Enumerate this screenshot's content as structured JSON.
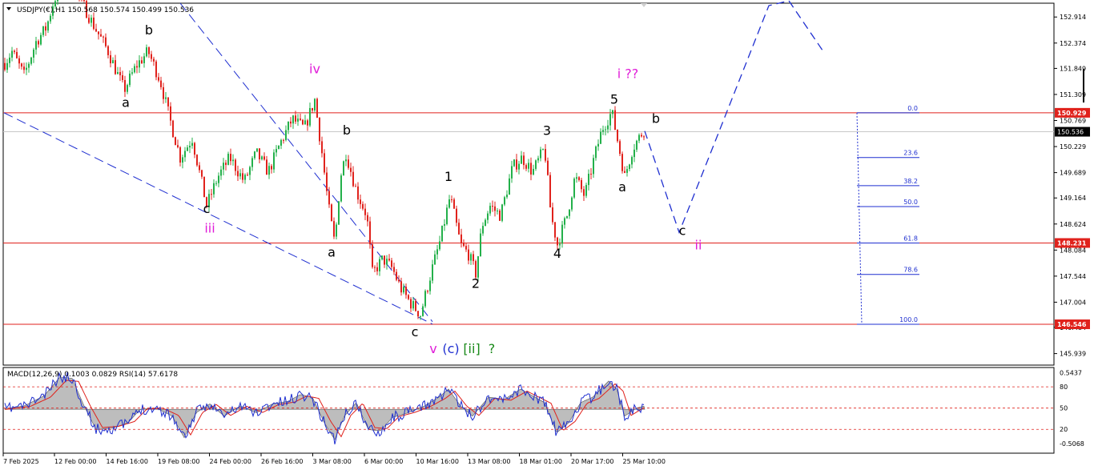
{
  "header": {
    "symbol_line": "USDJPY(€),H1  150.568 150.574 150.499 150.536",
    "indicator_line": "MACD(12,26,9) 0.1003 0.0829  RSI(14) 57.6178"
  },
  "colors": {
    "bull": "#23b04a",
    "bear": "#e0221c",
    "level": "#e0221c",
    "channel": "#1f2fd0",
    "projection": "#1f2fd0",
    "fib": "#1f2fd0",
    "magenta": "#e01cd8",
    "black": "#000000",
    "macd_hist": "#bdbdbd",
    "rsi": "#1f2fd0",
    "signal": "#e0221c",
    "green_label": "#1a8a1a"
  },
  "chart_data": [
    {
      "type": "line",
      "name": "price",
      "instrument": "USDJPY(€)",
      "timeframe": "H1",
      "ohlc": {
        "open": 150.568,
        "high": 150.574,
        "low": 150.499,
        "close": 150.536
      },
      "ylim": [
        145.7,
        153.2
      ],
      "y_ticks": [
        "152.914",
        "152.374",
        "151.849",
        "151.309",
        "150.769",
        "150.229",
        "149.689",
        "149.164",
        "148.624",
        "148.084",
        "147.544",
        "147.004",
        "146.484",
        "145.939"
      ],
      "x_ticks": [
        "7 Feb 2025",
        "12 Feb 00:00",
        "14 Feb 16:00",
        "19 Feb 08:00",
        "24 Feb 00:00",
        "26 Feb 16:00",
        "3 Mar 08:00",
        "6 Mar 00:00",
        "10 Mar 16:00",
        "13 Mar 08:00",
        "18 Mar 01:00",
        "20 Mar 17:00",
        "25 Mar 10:00"
      ],
      "swing_path": [
        [
          0,
          151.8
        ],
        [
          15,
          152.2
        ],
        [
          30,
          151.7
        ],
        [
          45,
          152.4
        ],
        [
          58,
          152.7
        ],
        [
          68,
          153.3
        ],
        [
          85,
          153.6
        ],
        [
          100,
          153.3
        ],
        [
          115,
          152.8
        ],
        [
          135,
          152.2
        ],
        [
          155,
          151.4
        ],
        [
          170,
          151.9
        ],
        [
          185,
          152.2
        ],
        [
          200,
          151.6
        ],
        [
          212,
          150.8
        ],
        [
          225,
          150.0
        ],
        [
          240,
          150.4
        ],
        [
          258,
          149.0
        ],
        [
          272,
          149.6
        ],
        [
          287,
          150.0
        ],
        [
          305,
          149.5
        ],
        [
          320,
          150.1
        ],
        [
          335,
          149.7
        ],
        [
          350,
          150.3
        ],
        [
          365,
          150.8
        ],
        [
          380,
          150.6
        ],
        [
          393,
          151.2
        ],
        [
          402,
          150.1
        ],
        [
          410,
          149.0
        ],
        [
          418,
          148.2
        ],
        [
          425,
          149.6
        ],
        [
          432,
          150.1
        ],
        [
          445,
          149.3
        ],
        [
          458,
          148.8
        ],
        [
          465,
          147.6
        ],
        [
          478,
          147.9
        ],
        [
          490,
          147.7
        ],
        [
          500,
          147.3
        ],
        [
          512,
          147.0
        ],
        [
          525,
          146.75
        ],
        [
          538,
          147.6
        ],
        [
          550,
          148.3
        ],
        [
          562,
          149.2
        ],
        [
          575,
          148.2
        ],
        [
          585,
          148.0
        ],
        [
          594,
          147.6
        ],
        [
          602,
          148.6
        ],
        [
          612,
          149.0
        ],
        [
          625,
          148.8
        ],
        [
          640,
          149.8
        ],
        [
          652,
          150.0
        ],
        [
          665,
          149.7
        ],
        [
          680,
          150.2
        ],
        [
          688,
          148.8
        ],
        [
          696,
          148.2
        ],
        [
          708,
          148.8
        ],
        [
          718,
          149.6
        ],
        [
          730,
          149.2
        ],
        [
          742,
          150.0
        ],
        [
          752,
          150.6
        ],
        [
          764,
          150.95
        ],
        [
          773,
          150.2
        ],
        [
          780,
          149.6
        ],
        [
          790,
          150.2
        ],
        [
          805,
          150.6
        ]
      ],
      "horizontal_levels": [
        {
          "label": "150.929",
          "value": 150.929
        },
        {
          "label": "148.231",
          "value": 148.231
        },
        {
          "label": "146.546",
          "value": 146.546
        }
      ],
      "current_price_label": "150.536",
      "current_price": 150.536,
      "fibonacci": [
        {
          "label": "0.0",
          "value": 150.929
        },
        {
          "label": "23.6",
          "value": 150.002
        },
        {
          "label": "38.2",
          "value": 149.418
        },
        {
          "label": "50.0",
          "value": 148.985
        },
        {
          "label": "61.8",
          "value": 148.231
        },
        {
          "label": "78.6",
          "value": 147.58
        },
        {
          "label": "100.0",
          "value": 146.546
        }
      ],
      "channel_lines": [
        {
          "from": [
            225,
            153.2
          ],
          "to": [
            540,
            146.6
          ]
        },
        {
          "from": [
            5,
            150.929
          ],
          "to": [
            540,
            146.55
          ]
        }
      ],
      "projection": [
        [
          805,
          150.55
        ],
        [
          848,
          148.45
        ],
        [
          960,
          153.15
        ],
        [
          985,
          153.25
        ],
        [
          1028,
          152.2
        ]
      ],
      "wave_labels": [
        {
          "text": "b",
          "x": 186,
          "y": 152.55,
          "color": "black"
        },
        {
          "text": "a",
          "x": 157,
          "y": 151.05,
          "color": "black"
        },
        {
          "text": "c",
          "x": 258,
          "y": 148.85,
          "color": "black"
        },
        {
          "text": "iii",
          "x": 262,
          "y": 148.45,
          "color": "magenta"
        },
        {
          "text": "iv",
          "x": 393,
          "y": 151.75,
          "color": "magenta"
        },
        {
          "text": "b",
          "x": 433,
          "y": 150.48,
          "color": "black"
        },
        {
          "text": "a",
          "x": 414,
          "y": 147.95,
          "color": "black"
        },
        {
          "text": "c",
          "x": 518,
          "y": 146.3,
          "color": "black"
        },
        {
          "text": "v",
          "x": 541,
          "y": 145.95,
          "color": "magenta"
        },
        {
          "text": "(c)",
          "x": 563,
          "y": 145.95,
          "color": "blue"
        },
        {
          "text": "[ii]",
          "x": 589,
          "y": 145.95,
          "color": "green"
        },
        {
          "text": "?",
          "x": 614,
          "y": 145.95,
          "color": "green"
        },
        {
          "text": "1",
          "x": 560,
          "y": 149.52,
          "color": "black"
        },
        {
          "text": "2",
          "x": 594,
          "y": 147.3,
          "color": "black"
        },
        {
          "text": "3",
          "x": 683,
          "y": 150.47,
          "color": "black"
        },
        {
          "text": "4",
          "x": 696,
          "y": 147.92,
          "color": "black"
        },
        {
          "text": "5",
          "x": 767,
          "y": 151.12,
          "color": "black"
        },
        {
          "text": "i ??",
          "x": 784,
          "y": 151.65,
          "color": "magenta"
        },
        {
          "text": "b",
          "x": 819,
          "y": 150.72,
          "color": "black"
        },
        {
          "text": "a",
          "x": 777,
          "y": 149.3,
          "color": "black"
        },
        {
          "text": "c",
          "x": 852,
          "y": 148.4,
          "color": "black"
        },
        {
          "text": "ii",
          "x": 872,
          "y": 148.1,
          "color": "magenta"
        }
      ]
    },
    {
      "type": "line",
      "name": "oscillator",
      "ylim": [
        -0.65,
        0.62
      ],
      "y_ticks": [
        "0.5437",
        "80",
        "50",
        "20",
        "-0.5068"
      ],
      "rsi_levels": [
        80,
        50,
        20
      ],
      "swing_path": [
        [
          0,
          0.0
        ],
        [
          30,
          0.05
        ],
        [
          55,
          0.2
        ],
        [
          75,
          0.48
        ],
        [
          90,
          0.46
        ],
        [
          105,
          0.05
        ],
        [
          120,
          -0.3
        ],
        [
          140,
          -0.28
        ],
        [
          160,
          -0.2
        ],
        [
          175,
          0.0
        ],
        [
          195,
          0.02
        ],
        [
          215,
          -0.1
        ],
        [
          230,
          -0.42
        ],
        [
          245,
          -0.05
        ],
        [
          262,
          0.08
        ],
        [
          280,
          -0.1
        ],
        [
          300,
          0.05
        ],
        [
          320,
          -0.05
        ],
        [
          340,
          0.08
        ],
        [
          360,
          0.12
        ],
        [
          375,
          0.22
        ],
        [
          390,
          0.18
        ],
        [
          405,
          -0.2
        ],
        [
          418,
          -0.45
        ],
        [
          430,
          -0.1
        ],
        [
          445,
          0.1
        ],
        [
          460,
          -0.3
        ],
        [
          475,
          -0.32
        ],
        [
          490,
          -0.12
        ],
        [
          510,
          -0.05
        ],
        [
          530,
          0.05
        ],
        [
          548,
          0.18
        ],
        [
          560,
          0.3
        ],
        [
          575,
          0.05
        ],
        [
          590,
          -0.1
        ],
        [
          610,
          0.18
        ],
        [
          630,
          0.15
        ],
        [
          650,
          0.3
        ],
        [
          665,
          0.2
        ],
        [
          680,
          0.1
        ],
        [
          695,
          -0.35
        ],
        [
          710,
          -0.2
        ],
        [
          725,
          0.1
        ],
        [
          740,
          0.18
        ],
        [
          760,
          0.42
        ],
        [
          770,
          0.3
        ],
        [
          780,
          -0.1
        ],
        [
          795,
          0.02
        ],
        [
          805,
          0.05
        ]
      ]
    }
  ]
}
